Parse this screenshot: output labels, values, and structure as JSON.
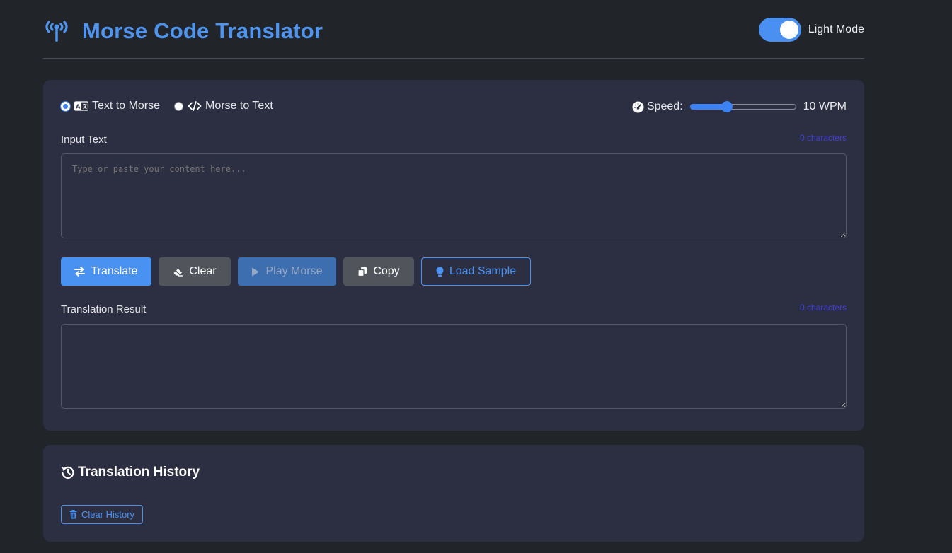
{
  "header": {
    "title": "Morse Code Translator",
    "title_icon": "broadcast-tower-icon",
    "mode_toggle_label": "Light Mode",
    "mode_toggle_on": true
  },
  "options": {
    "modes": [
      {
        "label": "Text to Morse",
        "icon": "language-icon",
        "checked": true
      },
      {
        "label": "Morse to Text",
        "icon": "code-icon",
        "checked": false
      }
    ],
    "speed_label": "Speed:",
    "speed_icon": "tachometer-icon",
    "speed_value": 10,
    "speed_display": "10 WPM",
    "speed_level": 0.35
  },
  "input": {
    "label": "Input Text",
    "char_count": "0 characters",
    "value": "",
    "placeholder": "Type or paste your content here..."
  },
  "buttons": {
    "translate": "Translate",
    "clear": "Clear",
    "play": "Play Morse",
    "copy": "Copy",
    "load_sample": "Load Sample"
  },
  "result": {
    "label": "Translation Result",
    "char_count": "0 characters",
    "value": ""
  },
  "history": {
    "title": "Translation History",
    "clear_label": "Clear History"
  },
  "colors": {
    "background": "#212429",
    "card": "#2c2e42",
    "accent": "#4a92f2",
    "title": "#4f94ee",
    "char_count": "#4340d8"
  }
}
